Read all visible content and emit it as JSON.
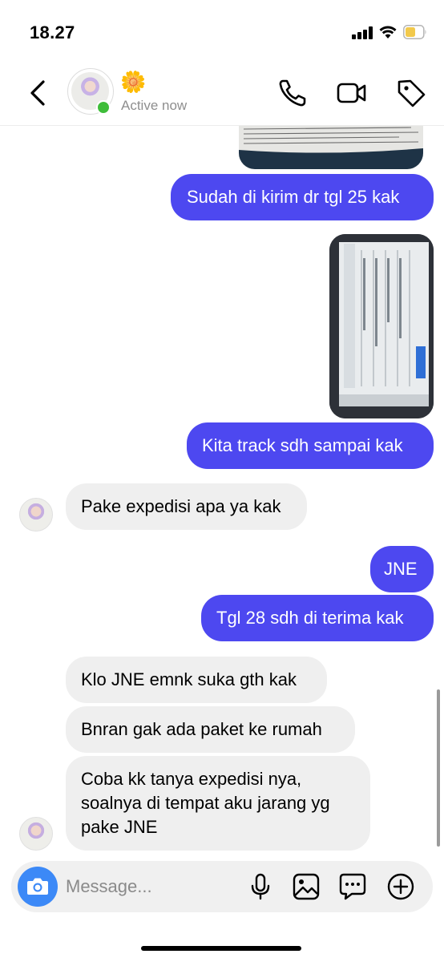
{
  "status_bar": {
    "time": "18.27",
    "battery_color": "#f2c94c"
  },
  "header": {
    "emoji": "🌼",
    "status": "Active now",
    "icons": [
      "back-chevron-icon",
      "phone-icon",
      "video-camera-icon",
      "tag-icon"
    ]
  },
  "colors": {
    "outgoing": "#4d48f0",
    "incoming": "#efefef",
    "camera": "#3c89f7",
    "online": "#3fbd3a"
  },
  "messages": [
    {
      "from": "me",
      "type": "image",
      "desc": "receipt"
    },
    {
      "from": "me",
      "text": "Sudah di kirim dr tgl 25 kak"
    },
    {
      "from": "me",
      "type": "image",
      "desc": "tracking screenshot"
    },
    {
      "from": "me",
      "text": "Kita track sdh sampai kak"
    },
    {
      "from": "them",
      "text": "Pake expedisi apa ya kak"
    },
    {
      "from": "me",
      "text": "JNE"
    },
    {
      "from": "me",
      "text": "Tgl 28 sdh di terima kak"
    },
    {
      "from": "them",
      "text": "Klo JNE emnk suka gth kak"
    },
    {
      "from": "them",
      "text": "Bnran gak ada paket ke rumah"
    },
    {
      "from": "them",
      "text": "Coba kk tanya expedisi nya,\nsoalnya di tempat aku jarang yg\npake JNE"
    }
  ],
  "composer": {
    "placeholder": "Message...",
    "icons": [
      "camera-icon",
      "microphone-icon",
      "gallery-icon",
      "sticker-icon",
      "plus-icon"
    ]
  }
}
